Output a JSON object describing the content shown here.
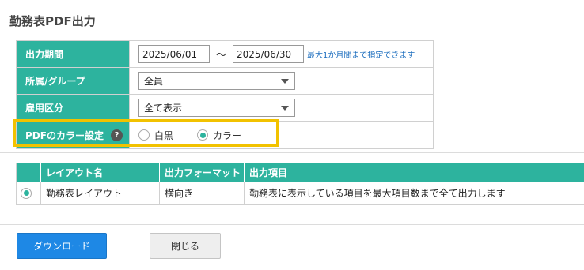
{
  "page": {
    "title": "勤務表PDF出力"
  },
  "form": {
    "period": {
      "label": "出力期間",
      "start": "2025/06/01",
      "separator": "～",
      "end": "2025/06/30",
      "note": "最大1か月間まで指定できます"
    },
    "group": {
      "label": "所属/グループ",
      "selected": "全員"
    },
    "employment": {
      "label": "雇用区分",
      "selected": "全て表示"
    },
    "color": {
      "label": "PDFのカラー設定",
      "help_icon": "question-circle-icon",
      "options": [
        "白黒",
        "カラー"
      ],
      "selected": "カラー"
    }
  },
  "layout_table": {
    "headers": [
      "",
      "レイアウト名",
      "出力フォーマット",
      "出力項目"
    ],
    "rows": [
      {
        "selected": true,
        "name": "勤務表レイアウト",
        "format": "横向き",
        "items": "勤務表に表示している項目を最大項目数まで全て出力します"
      }
    ]
  },
  "buttons": {
    "download": "ダウンロード",
    "close": "閉じる"
  },
  "colors": {
    "accent": "#2db39e",
    "primary_button": "#1e88e5",
    "highlight": "#f2c200",
    "link": "#1e6fbf"
  }
}
